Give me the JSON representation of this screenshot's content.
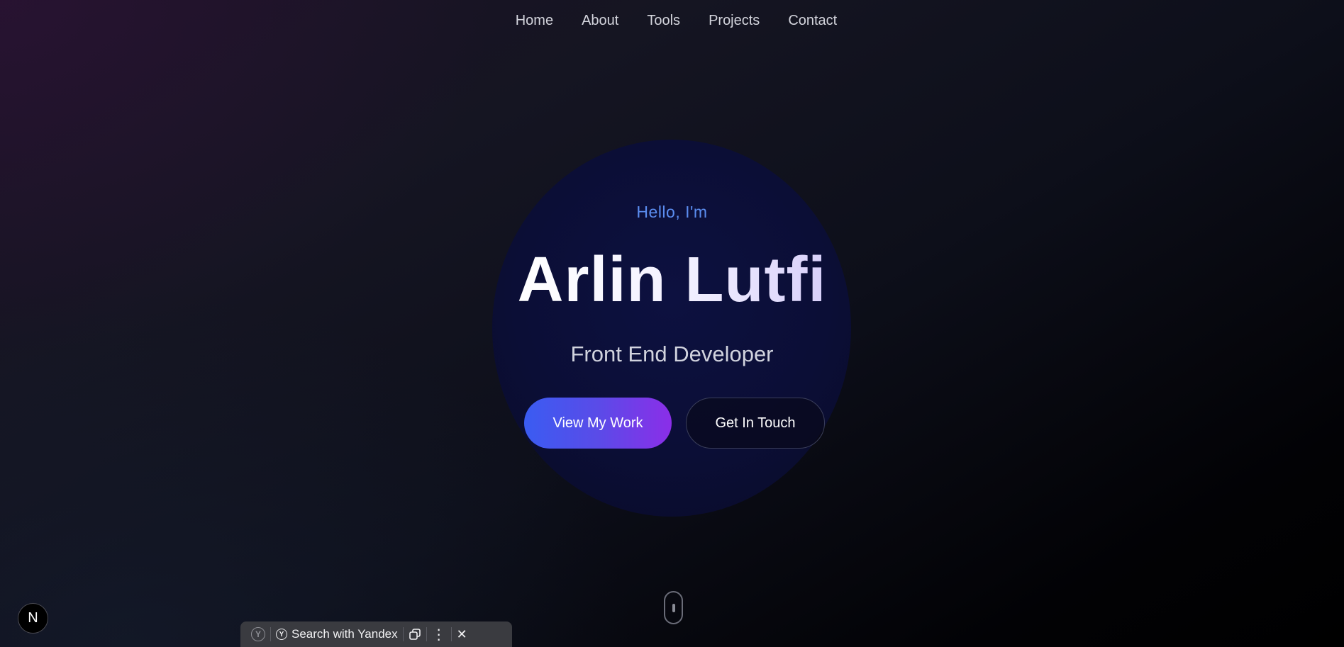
{
  "nav": {
    "items": [
      "Home",
      "About",
      "Tools",
      "Projects",
      "Contact"
    ]
  },
  "hero": {
    "greeting": "Hello, I'm",
    "name": "Arlin Lutfi",
    "role": "Front End Developer",
    "primary_button": "View My Work",
    "secondary_button": "Get In Touch"
  },
  "badge": {
    "letter": "N"
  },
  "yandex_bar": {
    "search_label": "Search with Yandex",
    "logo_glyph": "Y",
    "close_glyph": "✕",
    "more_glyph": "⋮"
  },
  "colors": {
    "accent_blue": "#5b8df0",
    "button_gradient_start": "#3a5cf2",
    "button_gradient_end": "#8b2ee8",
    "background": "#0d0f1a"
  },
  "icons": {
    "logo": "yandex-logo-icon",
    "search": "yandex-search-icon",
    "copy": "copy-icon",
    "more": "more-vertical-icon",
    "close": "close-icon",
    "scroll": "mouse-scroll-icon"
  }
}
